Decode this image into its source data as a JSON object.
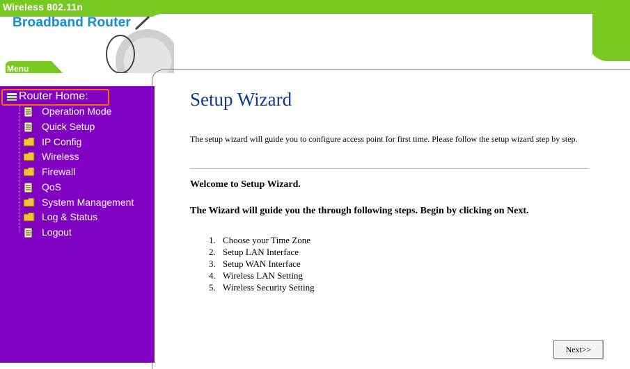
{
  "header": {
    "brand_line1": "Wireless 802.11n",
    "brand_line2": "Broadband Router",
    "menu_tab": "Menu",
    "colors": {
      "green": "#77c81f",
      "blue": "#1a8fd0"
    }
  },
  "sidebar": {
    "background": "#8102c2",
    "home_label": "Router Home:",
    "home_icon": "stack-icon",
    "items": [
      {
        "label": "Operation Mode",
        "icon": "page-icon"
      },
      {
        "label": "Quick Setup",
        "icon": "page-icon"
      },
      {
        "label": "IP Config",
        "icon": "folder-icon"
      },
      {
        "label": "Wireless",
        "icon": "folder-icon"
      },
      {
        "label": "Firewall",
        "icon": "folder-icon"
      },
      {
        "label": "QoS",
        "icon": "page-icon"
      },
      {
        "label": "System Management",
        "icon": "folder-icon"
      },
      {
        "label": "Log & Status",
        "icon": "folder-icon"
      },
      {
        "label": "Logout",
        "icon": "page-icon"
      }
    ]
  },
  "main": {
    "title": "Setup Wizard",
    "intro": "The setup wizard will guide you to configure access point for first time. Please follow the setup wizard step by step.",
    "welcome": "Welcome to Setup Wizard.",
    "guide": "The Wizard will guide you the through following steps. Begin by clicking on Next.",
    "steps": [
      "Choose your Time Zone",
      "Setup LAN Interface",
      "Setup WAN Interface",
      "Wireless LAN Setting",
      "Wireless Security Setting"
    ],
    "next_button": "Next>>"
  }
}
